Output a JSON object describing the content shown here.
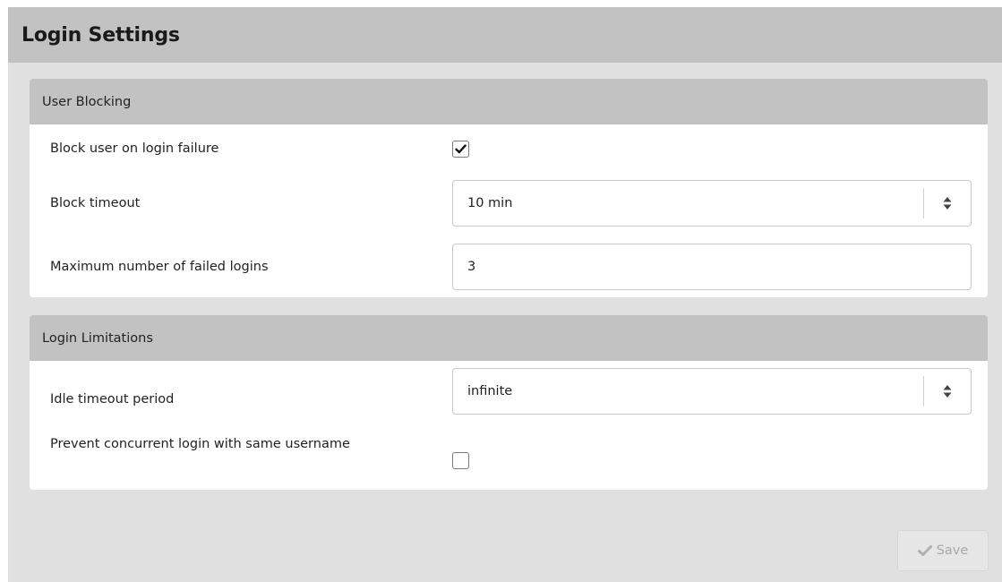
{
  "page": {
    "title": "Login Settings"
  },
  "user_blocking": {
    "header": "User Blocking",
    "block_on_failure": {
      "label": "Block user on login failure",
      "checked": true
    },
    "block_timeout": {
      "label": "Block timeout",
      "value": "10 min"
    },
    "max_failed_logins": {
      "label": "Maximum number of failed logins",
      "value": "3"
    }
  },
  "login_limitations": {
    "header": "Login Limitations",
    "idle_timeout": {
      "label": "Idle timeout period",
      "value": "infinite"
    },
    "prevent_concurrent": {
      "label": "Prevent concurrent login with same username",
      "checked": false
    }
  },
  "footer": {
    "save_label": "Save",
    "save_icon": "checkmark-icon"
  },
  "colors": {
    "page_background": "#e0e0e0",
    "header_background": "#c2c2c2",
    "panel_background": "#ffffff",
    "disabled_text": "#a8a8a8"
  }
}
